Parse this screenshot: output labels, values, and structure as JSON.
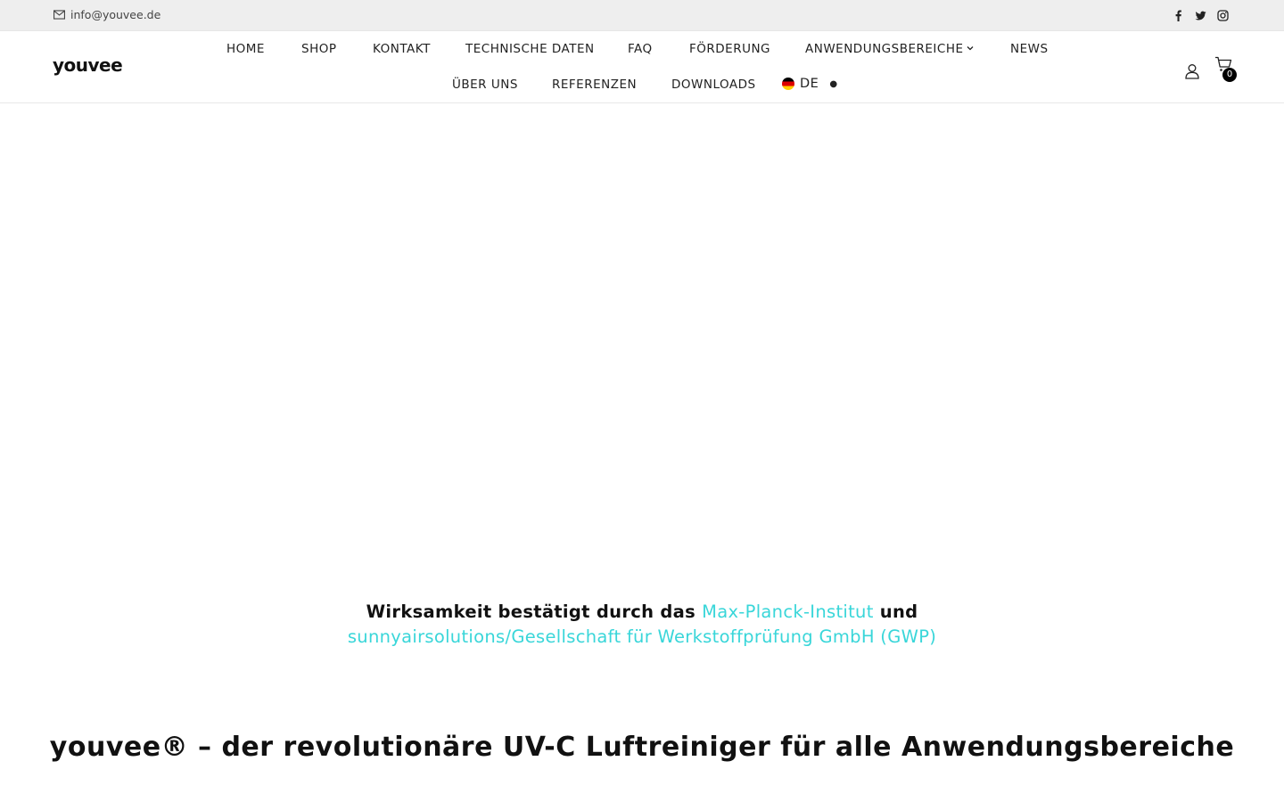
{
  "topbar": {
    "email": "info@youvee.de",
    "email_icon": "envelope-icon",
    "social": [
      "facebook-icon",
      "twitter-icon",
      "instagram-icon"
    ]
  },
  "header": {
    "logo_text": "youvee",
    "nav_row1": [
      "HOME",
      "SHOP",
      "KONTAKT",
      "TECHNISCHE DATEN",
      "FAQ",
      "FÖRDERUNG",
      "ANWENDUNGSBEREICHE",
      "NEWS"
    ],
    "nav_row2": [
      "ÜBER UNS",
      "REFERENZEN",
      "DOWNLOADS"
    ],
    "language": "DE",
    "cart_count": "0"
  },
  "main": {
    "efficacy_prefix": "Wirksamkeit bestätigt durch das ",
    "efficacy_link1": "Max-Planck-Institut",
    "efficacy_mid": " und ",
    "efficacy_link2": "sunnyairsolutions/Gesellschaft für Werkstoffprüfung GmbH (GWP)",
    "headline": "youvee® – der revolutionäre UV-C Luftreiniger für alle Anwendungsbereiche"
  },
  "colors": {
    "accent_link": "#39d6d9",
    "topbar_bg": "#eeeeee"
  }
}
